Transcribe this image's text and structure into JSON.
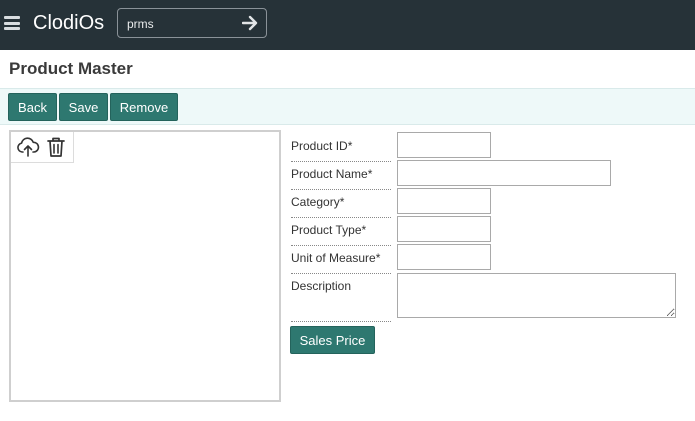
{
  "header": {
    "brand": "ClodiOs",
    "search_value": "prms",
    "menu_icon": "hamburger-menu-icon",
    "go_icon": "arrow-right-icon"
  },
  "page": {
    "title": "Product Master"
  },
  "toolbar": {
    "back_label": "Back",
    "save_label": "Save",
    "remove_label": "Remove"
  },
  "image_panel": {
    "upload_icon": "upload-cloud-icon",
    "delete_icon": "trash-icon"
  },
  "form": {
    "product_id_label": "Product ID*",
    "product_id_value": "",
    "product_name_label": "Product Name*",
    "product_name_value": "",
    "category_label": "Category*",
    "category_value": "",
    "product_type_label": "Product Type*",
    "product_type_value": "",
    "uom_label": "Unit of Measure*",
    "uom_value": "",
    "description_label": "Description",
    "description_value": "",
    "sales_price_label": "Sales Price"
  },
  "colors": {
    "topbar": "#263238",
    "accent": "#2e7870",
    "toolbar_bg": "#eef9f9"
  }
}
